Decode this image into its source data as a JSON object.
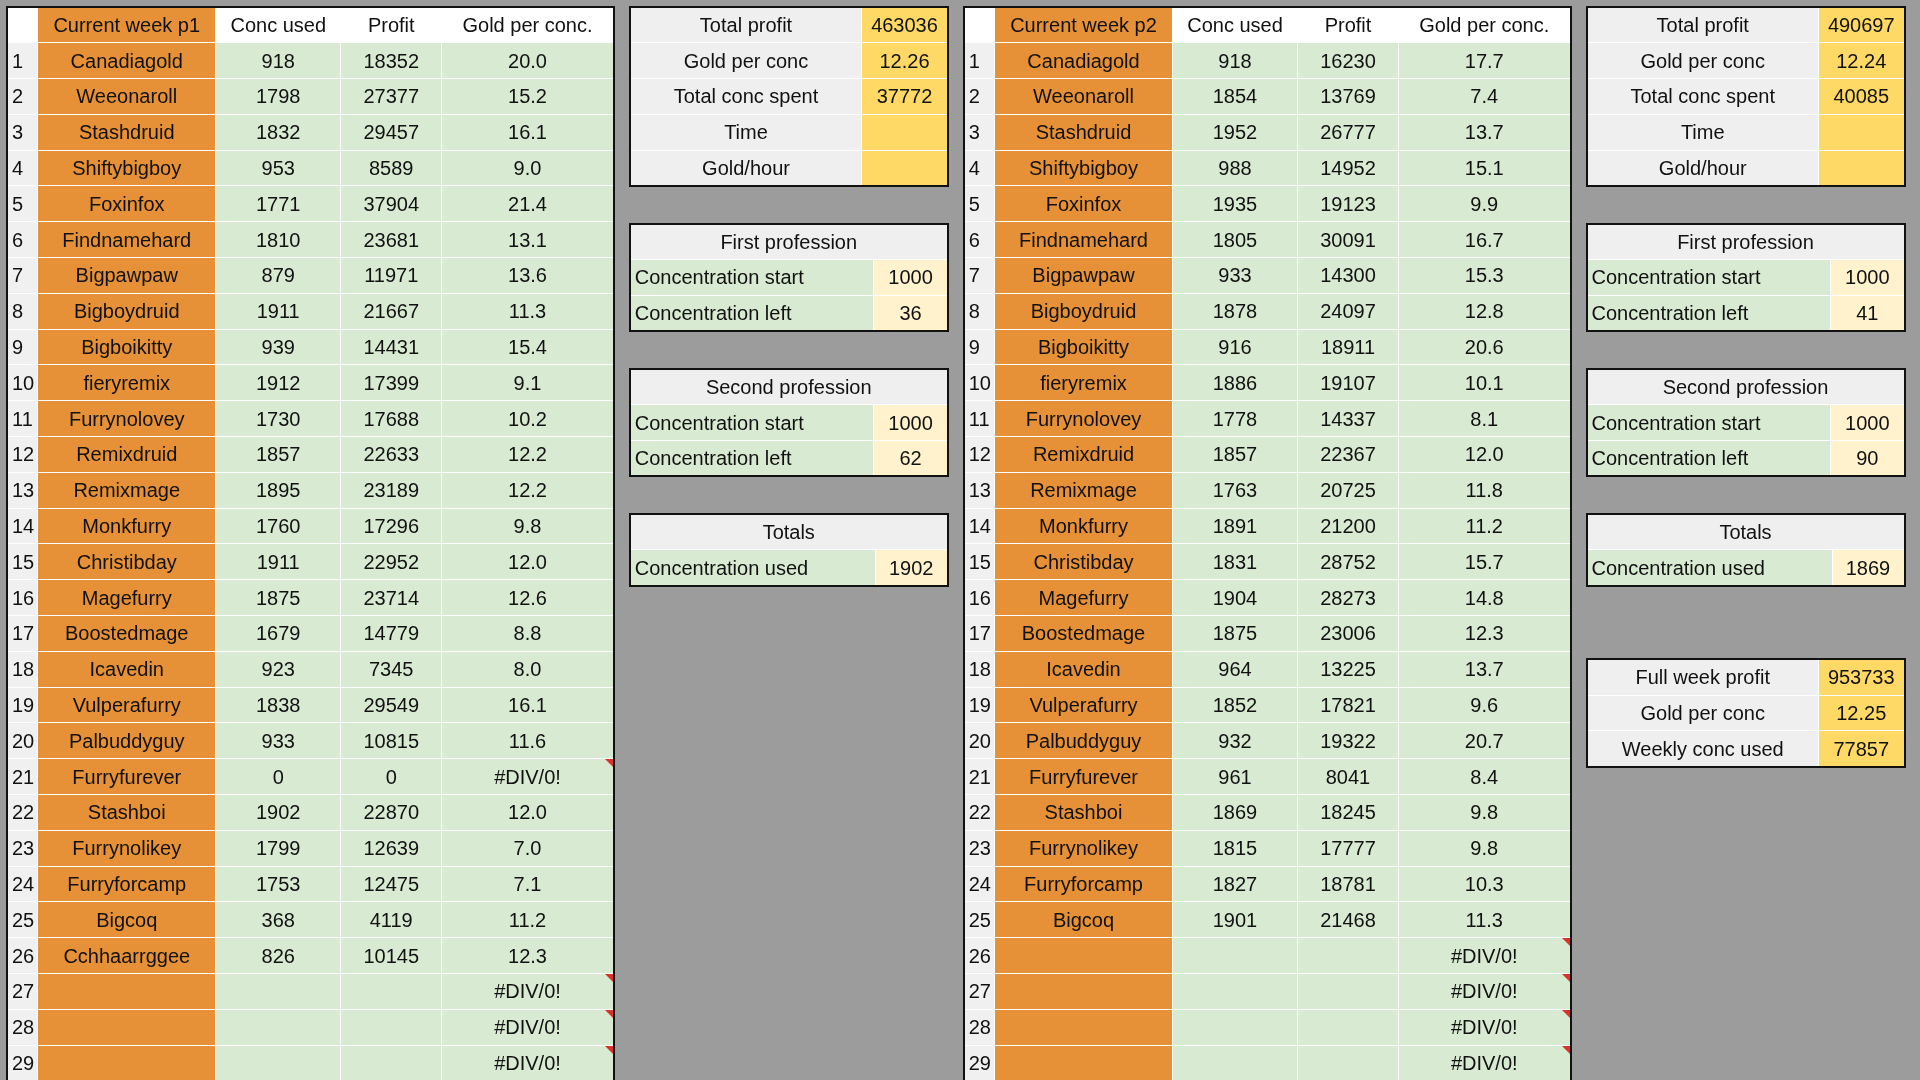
{
  "sheets": [
    {
      "table": {
        "columns": [
          "Current week p1",
          "Conc used",
          "Profit",
          "Gold per conc."
        ],
        "rows": [
          {
            "index": "1",
            "name": "Canadiagold",
            "conc": "918",
            "profit": "18352",
            "gold": "20.0",
            "comment": false
          },
          {
            "index": "2",
            "name": "Weeonaroll",
            "conc": "1798",
            "profit": "27377",
            "gold": "15.2",
            "comment": false
          },
          {
            "index": "3",
            "name": "Stashdruid",
            "conc": "1832",
            "profit": "29457",
            "gold": "16.1",
            "comment": false
          },
          {
            "index": "4",
            "name": "Shiftybigboy",
            "conc": "953",
            "profit": "8589",
            "gold": "9.0",
            "comment": false
          },
          {
            "index": "5",
            "name": "Foxinfox",
            "conc": "1771",
            "profit": "37904",
            "gold": "21.4",
            "comment": false
          },
          {
            "index": "6",
            "name": "Findnamehard",
            "conc": "1810",
            "profit": "23681",
            "gold": "13.1",
            "comment": false
          },
          {
            "index": "7",
            "name": "Bigpawpaw",
            "conc": "879",
            "profit": "11971",
            "gold": "13.6",
            "comment": false
          },
          {
            "index": "8",
            "name": "Bigboydruid",
            "conc": "1911",
            "profit": "21667",
            "gold": "11.3",
            "comment": false
          },
          {
            "index": "9",
            "name": "Bigboikitty",
            "conc": "939",
            "profit": "14431",
            "gold": "15.4",
            "comment": false
          },
          {
            "index": "10",
            "name": "fieryremix",
            "conc": "1912",
            "profit": "17399",
            "gold": "9.1",
            "comment": false
          },
          {
            "index": "11",
            "name": "Furrynolovey",
            "conc": "1730",
            "profit": "17688",
            "gold": "10.2",
            "comment": false
          },
          {
            "index": "12",
            "name": "Remixdruid",
            "conc": "1857",
            "profit": "22633",
            "gold": "12.2",
            "comment": false
          },
          {
            "index": "13",
            "name": "Remixmage",
            "conc": "1895",
            "profit": "23189",
            "gold": "12.2",
            "comment": false
          },
          {
            "index": "14",
            "name": "Monkfurry",
            "conc": "1760",
            "profit": "17296",
            "gold": "9.8",
            "comment": false
          },
          {
            "index": "15",
            "name": "Christibday",
            "conc": "1911",
            "profit": "22952",
            "gold": "12.0",
            "comment": false
          },
          {
            "index": "16",
            "name": "Magefurry",
            "conc": "1875",
            "profit": "23714",
            "gold": "12.6",
            "comment": false
          },
          {
            "index": "17",
            "name": "Boostedmage",
            "conc": "1679",
            "profit": "14779",
            "gold": "8.8",
            "comment": false
          },
          {
            "index": "18",
            "name": "Icavedin",
            "conc": "923",
            "profit": "7345",
            "gold": "8.0",
            "comment": false
          },
          {
            "index": "19",
            "name": "Vulperafurry",
            "conc": "1838",
            "profit": "29549",
            "gold": "16.1",
            "comment": false
          },
          {
            "index": "20",
            "name": "Palbuddyguy",
            "conc": "933",
            "profit": "10815",
            "gold": "11.6",
            "comment": false
          },
          {
            "index": "21",
            "name": "Furryfurever",
            "conc": "0",
            "profit": "0",
            "gold": "#DIV/0!",
            "comment": true
          },
          {
            "index": "22",
            "name": "Stashboi",
            "conc": "1902",
            "profit": "22870",
            "gold": "12.0",
            "comment": false
          },
          {
            "index": "23",
            "name": "Furrynolikey",
            "conc": "1799",
            "profit": "12639",
            "gold": "7.0",
            "comment": false
          },
          {
            "index": "24",
            "name": "Furryforcamp",
            "conc": "1753",
            "profit": "12475",
            "gold": "7.1",
            "comment": false
          },
          {
            "index": "25",
            "name": "Bigcoq",
            "conc": "368",
            "profit": "4119",
            "gold": "11.2",
            "comment": false
          },
          {
            "index": "26",
            "name": "Cchhaarrggee",
            "conc": "826",
            "profit": "10145",
            "gold": "12.3",
            "comment": false
          },
          {
            "index": "27",
            "gold": "#DIV/0!",
            "comment": true
          },
          {
            "index": "28",
            "gold": "#DIV/0!",
            "comment": true
          },
          {
            "index": "29",
            "gold": "#DIV/0!",
            "comment": true
          }
        ]
      },
      "panels": [
        {
          "kind": "summary",
          "rows": [
            {
              "label": "Total profit",
              "value": "463036"
            },
            {
              "label": "Gold per conc",
              "value": "12.26"
            },
            {
              "label": "Total conc spent",
              "value": "37772"
            },
            {
              "label": "Time"
            },
            {
              "label": "Gold/hour"
            }
          ]
        },
        {
          "kind": "section",
          "title": "First profession",
          "rows": [
            {
              "label": "Concentration start",
              "value": "1000"
            },
            {
              "label": "Concentration left",
              "value": "36"
            }
          ]
        },
        {
          "kind": "section",
          "title": "Second profession",
          "rows": [
            {
              "label": "Concentration start",
              "value": "1000"
            },
            {
              "label": "Concentration left",
              "value": "62"
            }
          ]
        },
        {
          "kind": "section",
          "title": "Totals",
          "rows": [
            {
              "label": "Concentration used",
              "value": "1902"
            }
          ]
        }
      ]
    },
    {
      "table": {
        "columns": [
          "Current week p2",
          "Conc used",
          "Profit",
          "Gold per conc."
        ],
        "rows": [
          {
            "index": "1",
            "name": "Canadiagold",
            "conc": "918",
            "profit": "16230",
            "gold": "17.7",
            "comment": false
          },
          {
            "index": "2",
            "name": "Weeonaroll",
            "conc": "1854",
            "profit": "13769",
            "gold": "7.4",
            "comment": false
          },
          {
            "index": "3",
            "name": "Stashdruid",
            "conc": "1952",
            "profit": "26777",
            "gold": "13.7",
            "comment": false
          },
          {
            "index": "4",
            "name": "Shiftybigboy",
            "conc": "988",
            "profit": "14952",
            "gold": "15.1",
            "comment": false
          },
          {
            "index": "5",
            "name": "Foxinfox",
            "conc": "1935",
            "profit": "19123",
            "gold": "9.9",
            "comment": false
          },
          {
            "index": "6",
            "name": "Findnamehard",
            "conc": "1805",
            "profit": "30091",
            "gold": "16.7",
            "comment": false
          },
          {
            "index": "7",
            "name": "Bigpawpaw",
            "conc": "933",
            "profit": "14300",
            "gold": "15.3",
            "comment": false
          },
          {
            "index": "8",
            "name": "Bigboydruid",
            "conc": "1878",
            "profit": "24097",
            "gold": "12.8",
            "comment": false
          },
          {
            "index": "9",
            "name": "Bigboikitty",
            "conc": "916",
            "profit": "18911",
            "gold": "20.6",
            "comment": false
          },
          {
            "index": "10",
            "name": "fieryremix",
            "conc": "1886",
            "profit": "19107",
            "gold": "10.1",
            "comment": false
          },
          {
            "index": "11",
            "name": "Furrynolovey",
            "conc": "1778",
            "profit": "14337",
            "gold": "8.1",
            "comment": false
          },
          {
            "index": "12",
            "name": "Remixdruid",
            "conc": "1857",
            "profit": "22367",
            "gold": "12.0",
            "comment": false
          },
          {
            "index": "13",
            "name": "Remixmage",
            "conc": "1763",
            "profit": "20725",
            "gold": "11.8",
            "comment": false
          },
          {
            "index": "14",
            "name": "Monkfurry",
            "conc": "1891",
            "profit": "21200",
            "gold": "11.2",
            "comment": false
          },
          {
            "index": "15",
            "name": "Christibday",
            "conc": "1831",
            "profit": "28752",
            "gold": "15.7",
            "comment": false
          },
          {
            "index": "16",
            "name": "Magefurry",
            "conc": "1904",
            "profit": "28273",
            "gold": "14.8",
            "comment": false
          },
          {
            "index": "17",
            "name": "Boostedmage",
            "conc": "1875",
            "profit": "23006",
            "gold": "12.3",
            "comment": false
          },
          {
            "index": "18",
            "name": "Icavedin",
            "conc": "964",
            "profit": "13225",
            "gold": "13.7",
            "comment": false
          },
          {
            "index": "19",
            "name": "Vulperafurry",
            "conc": "1852",
            "profit": "17821",
            "gold": "9.6",
            "comment": false
          },
          {
            "index": "20",
            "name": "Palbuddyguy",
            "conc": "932",
            "profit": "19322",
            "gold": "20.7",
            "comment": false
          },
          {
            "index": "21",
            "name": "Furryfurever",
            "conc": "961",
            "profit": "8041",
            "gold": "8.4",
            "comment": false
          },
          {
            "index": "22",
            "name": "Stashboi",
            "conc": "1869",
            "profit": "18245",
            "gold": "9.8",
            "comment": false
          },
          {
            "index": "23",
            "name": "Furrynolikey",
            "conc": "1815",
            "profit": "17777",
            "gold": "9.8",
            "comment": false
          },
          {
            "index": "24",
            "name": "Furryforcamp",
            "conc": "1827",
            "profit": "18781",
            "gold": "10.3",
            "comment": false
          },
          {
            "index": "25",
            "name": "Bigcoq",
            "conc": "1901",
            "profit": "21468",
            "gold": "11.3",
            "comment": false
          },
          {
            "index": "26",
            "gold": "#DIV/0!",
            "comment": true
          },
          {
            "index": "27",
            "gold": "#DIV/0!",
            "comment": true
          },
          {
            "index": "28",
            "gold": "#DIV/0!",
            "comment": true
          },
          {
            "index": "29",
            "gold": "#DIV/0!",
            "comment": true
          }
        ]
      },
      "panels": [
        {
          "kind": "summary",
          "rows": [
            {
              "label": "Total profit",
              "value": "490697"
            },
            {
              "label": "Gold per conc",
              "value": "12.24"
            },
            {
              "label": "Total conc spent",
              "value": "40085"
            },
            {
              "label": "Time"
            },
            {
              "label": "Gold/hour"
            }
          ]
        },
        {
          "kind": "section",
          "title": "First profession",
          "rows": [
            {
              "label": "Concentration start",
              "value": "1000"
            },
            {
              "label": "Concentration left",
              "value": "41"
            }
          ]
        },
        {
          "kind": "section",
          "title": "Second profession",
          "rows": [
            {
              "label": "Concentration start",
              "value": "1000"
            },
            {
              "label": "Concentration left",
              "value": "90"
            }
          ]
        },
        {
          "kind": "section",
          "title": "Totals",
          "rows": [
            {
              "label": "Concentration used",
              "value": "1869"
            }
          ]
        },
        {
          "kind": "grand_total",
          "rows": [
            {
              "label": "Full week profit",
              "value": "953733"
            },
            {
              "label": "Gold per conc",
              "value": "12.25"
            },
            {
              "label": "Weekly conc used",
              "value": "77857"
            }
          ]
        }
      ]
    }
  ]
}
